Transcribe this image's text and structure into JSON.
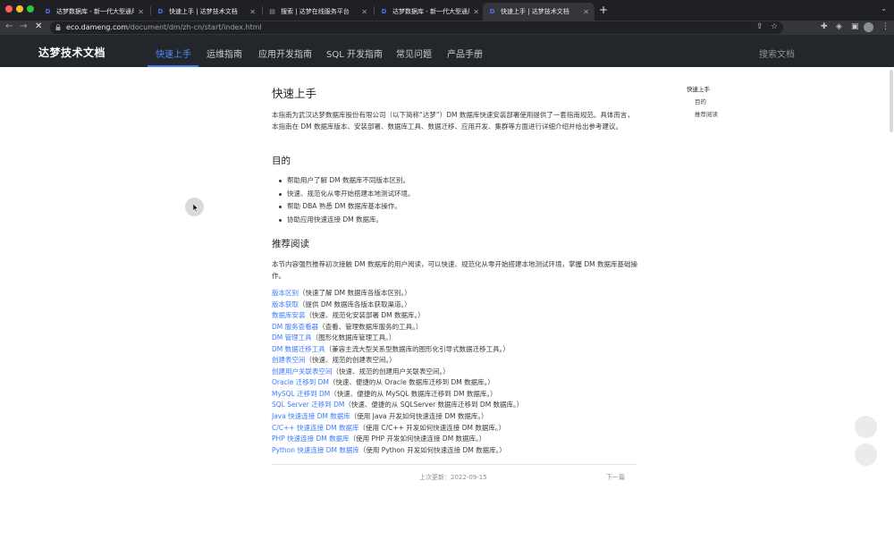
{
  "browser": {
    "tabs": [
      {
        "title": "达梦数据库 - 新一代大型通用关系型数...",
        "active": false
      },
      {
        "title": "快速上手 | 达梦技术文档",
        "active": false
      },
      {
        "title": "搜索 | 达梦在线服务平台",
        "active": false
      },
      {
        "title": "达梦数据库 - 新一代大型通用关系型数...",
        "active": false
      },
      {
        "title": "快速上手 | 达梦技术文档",
        "active": true
      }
    ],
    "url_host": "eco.dameng.com",
    "url_path": "/document/dm/zh-cn/start/index.html"
  },
  "site": {
    "logo": "达梦技术文档",
    "nav": [
      "快速上手",
      "运维指南",
      "应用开发指南",
      "SQL 开发指南",
      "常见问题",
      "产品手册"
    ],
    "active_nav_index": 0,
    "search_placeholder": "搜索文档"
  },
  "article": {
    "title": "快速上手",
    "intro": "本指南为武汉达梦数据库股份有限公司（以下简称“达梦”）DM 数据库快速安装部署使用提供了一套指南规范。具体而言，本指南在 DM 数据库版本、安装部署、数据库工具、数据迁移、应用开发、集群等方面进行详细介绍并给出参考建议。",
    "purpose_heading": "目的",
    "purpose_items": [
      "帮助用户了解 DM 数据库不同版本区别。",
      "快速、规范化从零开始搭建本地测试环境。",
      "帮助 DBA 熟悉 DM 数据库基本操作。",
      "协助应用快速连接 DM 数据库。"
    ],
    "reading_heading": "推荐阅读",
    "reading_intro": "本节内容强烈推荐初次接触 DM 数据库的用户阅读，可以快速、规范化从零开始搭建本地测试环境，掌握 DM 数据库基础操作。",
    "reading_links": [
      {
        "link": "版本区别",
        "desc": "（快速了解 DM 数据库各版本区别。）"
      },
      {
        "link": "版本获取",
        "desc": "（提供 DM 数据库各版本获取渠道。）"
      },
      {
        "link": "数据库安装",
        "desc": "（快速、规范化安装部署 DM 数据库。）"
      },
      {
        "link": "DM 服务查看器",
        "desc": "（查看、管理数据库服务的工具。）"
      },
      {
        "link": "DM 管理工具",
        "desc": "（图形化数据库管理工具。）"
      },
      {
        "link": "DM 数据迁移工具",
        "desc": "（兼容主流大型关系型数据库的图形化引导式数据迁移工具。）"
      },
      {
        "link": "创建表空间",
        "desc": "（快速、规范的创建表空间。）"
      },
      {
        "link": "创建用户关联表空间",
        "desc": "（快速、规范的创建用户关联表空间。）"
      },
      {
        "link": "Oracle 迁移到 DM",
        "desc": "（快速、便捷的从 Oracle 数据库迁移到 DM 数据库。）"
      },
      {
        "link": "MySQL 迁移到 DM",
        "desc": "（快速、便捷的从 MySQL 数据库迁移到 DM 数据库。）"
      },
      {
        "link": "SQL Server 迁移到 DM",
        "desc": "（快速、便捷的从 SQLServer 数据库迁移到 DM 数据库。）"
      },
      {
        "link": "Java 快速连接 DM 数据库",
        "desc": "（使用 Java 开发如何快速连接 DM 数据库。）"
      },
      {
        "link": "C/C++ 快速连接 DM 数据库",
        "desc": "（使用 C/C++ 开发如何快速连接 DM 数据库。）"
      },
      {
        "link": "PHP 快速连接 DM 数据库",
        "desc": "（使用 PHP 开发如何快速连接 DM 数据库。）"
      },
      {
        "link": "Python 快速连接 DM 数据库",
        "desc": "（使用 Python 开发如何快速连接 DM 数据库。）"
      }
    ],
    "updated": "上次更新：2022-09-15",
    "next": "下一篇"
  },
  "toc": {
    "items": [
      "快速上手",
      "目的",
      "推荐阅读"
    ]
  },
  "colors": {
    "accent": "#3d7bff",
    "header_bg": "#23262b",
    "tab_bg": "#1f2023"
  }
}
